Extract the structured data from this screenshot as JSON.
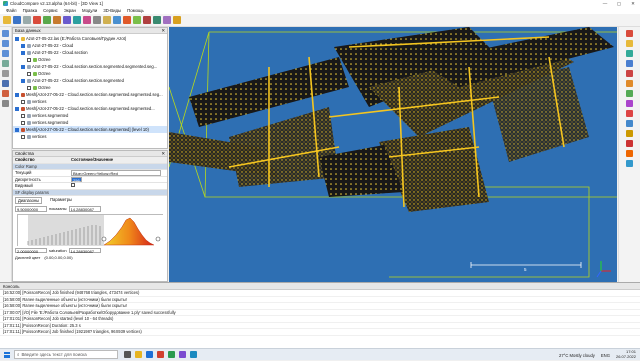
{
  "window": {
    "title": "CloudCompare v2.13.alpha (64-bit) - [3D View 1]",
    "controls": [
      "—",
      "▢",
      "✕"
    ]
  },
  "menu": [
    "Файл",
    "Правка",
    "Сервис",
    "Экран",
    "Модули",
    "3D-Виды",
    "Помощь"
  ],
  "db_panel": {
    "title": "База данных",
    "rows": [
      {
        "label": "Azot-27-05-22.las (E:/Работа Соловьев/Грудин Azot)",
        "level": 0,
        "checked": true,
        "icon": "folder-icon",
        "selected": false
      },
      {
        "label": "Azot-27-05-22 - Cloud",
        "level": 1,
        "checked": true,
        "icon": "cloud-icon",
        "selected": false
      },
      {
        "label": "Azot-27-05-22 - Cloud.section",
        "level": 1,
        "checked": true,
        "icon": "cloud-icon",
        "selected": false
      },
      {
        "label": "Octree",
        "level": 2,
        "checked": false,
        "icon": "octree-icon",
        "selected": false
      },
      {
        "label": "Azot-27-05-22 - Cloud.section.section.segmented.segmented.seg...",
        "level": 1,
        "checked": true,
        "icon": "cloud-icon",
        "selected": false
      },
      {
        "label": "Octree",
        "level": 2,
        "checked": false,
        "icon": "octree-icon",
        "selected": false
      },
      {
        "label": "Azot-27-05-22 - Cloud.section.section.segmented",
        "level": 1,
        "checked": true,
        "icon": "cloud-icon",
        "selected": false
      },
      {
        "label": "Octree",
        "level": 2,
        "checked": false,
        "icon": "octree-icon",
        "selected": false
      },
      {
        "label": "Mesh[Azot-27-05-22 - Cloud.section.section.segmented.segmented.seg...",
        "level": 0,
        "checked": true,
        "icon": "mesh-icon",
        "selected": false
      },
      {
        "label": "vertices",
        "level": 1,
        "checked": false,
        "icon": "cloud-icon",
        "selected": false
      },
      {
        "label": "Mesh[Azot-27-05-22 - Cloud.section.section.segmented.segmented...",
        "level": 0,
        "checked": true,
        "icon": "mesh-icon",
        "selected": false
      },
      {
        "label": "vertices.segmented",
        "level": 1,
        "checked": false,
        "icon": "cloud-icon",
        "selected": false
      },
      {
        "label": "vertices.segmented",
        "level": 1,
        "checked": false,
        "icon": "cloud-icon",
        "selected": false
      },
      {
        "label": "Mesh[Azot-27-05-22 - Cloud.section.section.segmented] (level 10)",
        "level": 0,
        "checked": true,
        "icon": "mesh-icon",
        "selected": true
      },
      {
        "label": "vertices",
        "level": 1,
        "checked": false,
        "icon": "cloud-icon",
        "selected": false
      }
    ]
  },
  "props_panel": {
    "title": "Свойства",
    "headers": [
      "Свойство",
      "Состояние/Значение"
    ],
    "rows": [
      {
        "k": "Color Ramp",
        "v": "",
        "section": true
      },
      {
        "k": "Текущий",
        "v": "Blue>Green>Yellow>Red",
        "section": false
      },
      {
        "k": "Дискретность",
        "v": "256",
        "section": false
      },
      {
        "k": "Видимый",
        "v": "",
        "section": false
      },
      {
        "k": "SF display params",
        "v": "",
        "section": true
      }
    ],
    "tabs": [
      "Диапазоны",
      "Параметры"
    ],
    "range_min": "9.50000000",
    "range_max": "14.28830087",
    "show_label": "показаны",
    "sat_min": "2.00000000",
    "sat_label": "saturation",
    "sat_max": "14.28830087",
    "nan_label": "Дисплей цвет",
    "nan_value": "(0.00,0.00,0.00)"
  },
  "console": {
    "title": "Консоль",
    "lines": [
      "[16:52:00] [PoissonRecon] Job finished (948768 triangles, 473474 vertices)",
      "[16:58:00] Ranee выделенные объекты (источники) были скрыты!",
      "[16:58:00] Ranee выделенные объекты (источники) были скрыты!",
      "[17:00:07] [I/O] File 'E:/Работа Соловьев/Разработки/Оборудование 1.ply' saved successfully",
      "[17:01:01] [PoissonRecon] Job started (level 10 - 64 threads)",
      "[17:01:11] [PoissonRecon] Duration: 25.3 s",
      "[17:01:11] [PoissonRecon] Job finished (192198? triangles, 96X939 vertices)"
    ]
  },
  "viewport": {
    "scale_label": "5",
    "axis_labels": [
      "X",
      "Y",
      "Z"
    ]
  },
  "taskbar": {
    "search_placeholder": "Введите здесь текст для поиска",
    "weather": "27°C  Mostly cloudy",
    "lang": "ENG",
    "time": "17:01",
    "date": "26.07.2022"
  },
  "colors": {
    "viewport_bg": "#2e6fb3",
    "bbox": "#b8d81c",
    "points_yellow": "#f2c21e",
    "points_dark": "#222222"
  }
}
